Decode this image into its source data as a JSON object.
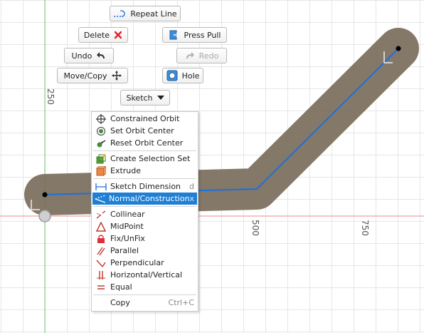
{
  "canvas": {
    "ruler_labels": [
      "250",
      "500",
      "750"
    ]
  },
  "marking_menu": {
    "repeat_line": "Repeat Line",
    "delete": "Delete",
    "press_pull": "Press Pull",
    "undo": "Undo",
    "redo": "Redo",
    "move_copy": "Move/Copy",
    "hole": "Hole",
    "sketch": "Sketch"
  },
  "context_menu": {
    "items": [
      {
        "label": "Constrained Orbit",
        "icon": "orbit-icon",
        "shortcut": ""
      },
      {
        "label": "Set Orbit Center",
        "icon": "target-icon",
        "shortcut": ""
      },
      {
        "label": "Reset Orbit Center",
        "icon": "reset-orbit-icon",
        "shortcut": ""
      },
      {
        "label": "Create Selection Set",
        "icon": "selection-set-icon",
        "shortcut": ""
      },
      {
        "label": "Extrude",
        "icon": "extrude-icon",
        "shortcut": ""
      },
      {
        "label": "Sketch Dimension",
        "icon": "dimension-icon",
        "shortcut": "d"
      },
      {
        "label": "Normal/Construction",
        "icon": "construction-icon",
        "shortcut": "x",
        "selected": true
      },
      {
        "label": "Collinear",
        "icon": "collinear-icon",
        "shortcut": ""
      },
      {
        "label": "MidPoint",
        "icon": "midpoint-icon",
        "shortcut": ""
      },
      {
        "label": "Fix/UnFix",
        "icon": "lock-icon",
        "shortcut": ""
      },
      {
        "label": "Parallel",
        "icon": "parallel-icon",
        "shortcut": ""
      },
      {
        "label": "Perpendicular",
        "icon": "perpendicular-icon",
        "shortcut": ""
      },
      {
        "label": "Horizontal/Vertical",
        "icon": "horizontal-vertical-icon",
        "shortcut": ""
      },
      {
        "label": "Equal",
        "icon": "equal-icon",
        "shortcut": ""
      },
      {
        "label": "Copy",
        "icon": "",
        "shortcut": "Ctrl+C"
      }
    ]
  },
  "colors": {
    "accent": "#1f7fd4",
    "slot_fill": "#7a6d5b",
    "sketch_line": "#1e6fdc",
    "axis_red": "#f08080",
    "axis_green": "#7bc67b",
    "delete_red": "#e0232c"
  }
}
